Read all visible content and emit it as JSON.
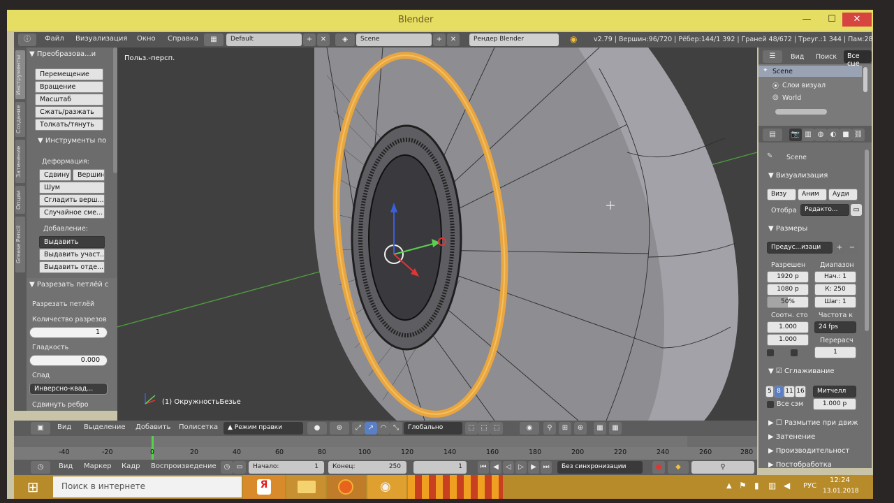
{
  "window": {
    "title": "Blender"
  },
  "info_header": {
    "menu": [
      "Файл",
      "Визуализация",
      "Окно",
      "Справка"
    ],
    "layout": "Default",
    "scene": "Scene",
    "engine": "Рендер Blender",
    "stats": "v2.79 | Вершин:96/720 | Рёбер:144/1 392 | Граней 48/672 | Треуг.:1 344 | Пам:28.26M"
  },
  "toolshelf": {
    "tabs": [
      "Инструменты",
      "Создание",
      "Затенение",
      "Опции",
      "Grease Pencil"
    ],
    "transform_header": "Преобразова...и",
    "transform_buttons": [
      "Перемещение",
      "Вращение",
      "Масштаб",
      "Сжать/разжать",
      "Толкать/тянуть"
    ],
    "tools_header": "Инструменты по",
    "deform_label": "Деформация:",
    "deform_row": [
      "Сдвину",
      "Вершин"
    ],
    "deform_buttons": [
      "Шум",
      "Сгладить верш...",
      "Случайное сме..."
    ],
    "add_label": "Добавление:",
    "add_buttons": [
      "Выдавить",
      "Выдавить участ...",
      "Выдавить отде..."
    ],
    "loopcut_header": "Разрезать петлёй с",
    "loopcut_label": "Разрезать петлёй",
    "cuts_label": "Количество разрезов",
    "cuts_value": "1",
    "smooth_label": "Гладкость",
    "smooth_value": "0.000",
    "falloff_label": "Спад",
    "falloff_value": "Инверсно-квад...",
    "slide_label": "Сдвинуть ребро"
  },
  "viewport": {
    "view_label": "Польз.-персп.",
    "object_label": "(1) ОкружностьБезье"
  },
  "outliner": {
    "menu": [
      "Вид",
      "Поиск"
    ],
    "filter": "Все сце",
    "items": [
      "Scene",
      "Слои визуал",
      "World"
    ]
  },
  "properties": {
    "scene": "Scene",
    "render_header": "Визуализация",
    "render_buttons": [
      "Визу",
      "Аним",
      "Ауди"
    ],
    "display_label": "Отобра",
    "display_value": "Редакто...",
    "dimensions_header": "Размеры",
    "preset_value": "Предус...изаци",
    "resolution_label": "Разрешен",
    "range_label": "Диапазон",
    "res_x": "1920 р",
    "res_y": "1080 р",
    "res_pct": "50%",
    "start": "Нач.: 1",
    "end": "К: 250",
    "step": "Шаг: 1",
    "aspect_label": "Соотн. сто",
    "fps_label": "Частота к",
    "aspect_x": "1.000",
    "aspect_y": "1.000",
    "fps": "24 fps",
    "remap_label": "Перерасч",
    "remap_value": "1",
    "aa_header": "Сглаживание",
    "aa_samples": [
      "5",
      "8",
      "11",
      "16"
    ],
    "aa_filter": "Митчелл",
    "full_sample": "Все сэм",
    "filter_size": "1.000 р",
    "motion_blur": "Размытие при движ",
    "shading": "Затенение",
    "performance": "Производительност",
    "post": "Постобработка"
  },
  "view_header": {
    "menu": [
      "Вид",
      "Выделение",
      "Добавить",
      "Полисетка"
    ],
    "mode": "Режим правки",
    "orientation": "Глобально"
  },
  "timeline": {
    "ticks": [
      "-40",
      "-20",
      "0",
      "20",
      "40",
      "60",
      "80",
      "100",
      "120",
      "140",
      "160",
      "180",
      "200",
      "220",
      "240",
      "260",
      "280"
    ],
    "menu": [
      "Вид",
      "Маркер",
      "Кадр",
      "Воспроизведение"
    ],
    "start_label": "Начало:",
    "start_value": "1",
    "end_label": "Конец:",
    "end_value": "250",
    "current": "1",
    "sync": "Без синхронизации"
  },
  "taskbar": {
    "search_placeholder": "Поиск в интернете",
    "lang": "РУС",
    "time": "12:24",
    "date": "13.01.2018"
  },
  "colors": {
    "accent": "#e6dd63",
    "selection": "#f0a030",
    "viewport": "#404040"
  }
}
